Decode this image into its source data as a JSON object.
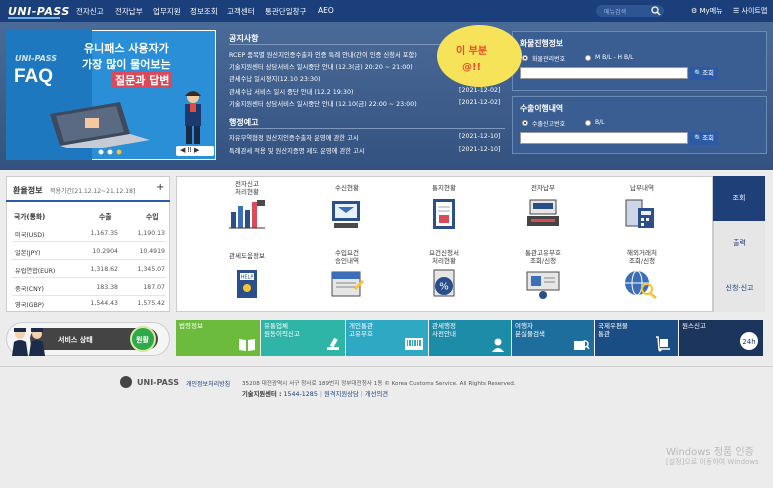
{
  "header": {
    "logo": "UNI-PASS",
    "nav": [
      "전자신고",
      "전자납부",
      "업무지원",
      "정보조회",
      "고객센터",
      "통관단일창구",
      "AEO"
    ],
    "search_placeholder": "메뉴검색",
    "my_menu": "My메뉴",
    "sitemap": "사이트맵"
  },
  "banner": {
    "logo": "UNI-PASS",
    "faq": "FAQ",
    "headline_1": "유니패스 사용자가",
    "headline_2": "가장 많이 물어보는",
    "headline_3": "질문과 답변",
    "controls": "◀ II ▶"
  },
  "notice": {
    "title": "공지사항",
    "items": [
      {
        "text": "RCEP 품목별 원산지인증수출자 인증 특례 안내(간이 인증 신청서 포함)",
        "date": ""
      },
      {
        "text": "기술지원센터 상담서비스 일시중단 안내 (12.3(금) 20:20 ~ 21:00)",
        "date": ""
      },
      {
        "text": "관세수납 일시정지(12.10 23:30)",
        "date": ""
      },
      {
        "text": "관세수납 서비스 일시 중단 안내 (12.2 19:30)",
        "date": "[2021-12-02]"
      },
      {
        "text": "기술지원센터 상담서비스 일시중단 안내 (12.10(금) 22:00 ~ 23:00)",
        "date": "[2021-12-02]"
      }
    ]
  },
  "admin_notice": {
    "title": "행정예고",
    "items": [
      {
        "text": "자유무역협정 원산지인증수출자 운영에 관한 고시",
        "date": "[2021-12-10]"
      },
      {
        "text": "특례관세 적용 및 원산지증명 제도 운영에 관한 고시",
        "date": "[2021-12-10]"
      }
    ]
  },
  "cargo": {
    "title": "화물진행정보",
    "radio_1": "화물관리번호",
    "radio_2": "M B/L - H B/L",
    "button": "조회"
  },
  "export": {
    "title": "수출이행내역",
    "radio_1": "수출신고번호",
    "radio_2": "B/L",
    "button": "조회"
  },
  "bubble": {
    "line_1": "이 부분",
    "line_2": "@!!",
    "color": "#f7e35a"
  },
  "rates": {
    "title": "환율정보",
    "period": "적용기간[21.12.12~21.12.18]",
    "plus": "+",
    "headers": [
      "국가(통화)",
      "수출",
      "수입"
    ],
    "rows": [
      {
        "country": "미국(USD)",
        "export": "1,167.35",
        "import": "1,190.13"
      },
      {
        "country": "일본(JPY)",
        "export": "10.2904",
        "import": "10.4919"
      },
      {
        "country": "유럽연합(EUR)",
        "export": "1,318.62",
        "import": "1,345.07"
      },
      {
        "country": "중국(CNY)",
        "export": "183.38",
        "import": "187.07"
      },
      {
        "country": "영국(GBP)",
        "export": "1,544.43",
        "import": "1,575.42"
      }
    ]
  },
  "status": {
    "label": "서비스 상태",
    "state": "원활"
  },
  "services": [
    {
      "label": "전자신고\n처리현황",
      "icon": "bar-chart-icon"
    },
    {
      "label": "수신현황",
      "icon": "mail-monitor-icon"
    },
    {
      "label": "통지현황",
      "icon": "document-icon"
    },
    {
      "label": "전자납부",
      "icon": "payment-terminal-icon"
    },
    {
      "label": "납부내역",
      "icon": "receipt-calculator-icon"
    },
    {
      "label": "관세도움정보",
      "icon": "help-book-icon"
    },
    {
      "label": "수입요건\n승인내역",
      "icon": "import-doc-icon"
    },
    {
      "label": "요건신청서\n처리현황",
      "icon": "percent-doc-icon"
    },
    {
      "label": "통관고유부호\n조회/신청",
      "icon": "id-board-icon"
    },
    {
      "label": "해외거래처\n조회/신청",
      "icon": "globe-search-icon"
    }
  ],
  "tabs": [
    "조회",
    "출력",
    "신청·신고"
  ],
  "quick_links": [
    {
      "label": "법령정보",
      "color": "#6dbb3d"
    },
    {
      "label": "유통업체\n원동이력신고",
      "color": "#2fb5a8"
    },
    {
      "label": "개인통관\n고유부호",
      "color": "#2fa8c4"
    },
    {
      "label": "관세행정\n사전안내",
      "color": "#1c8ca8"
    },
    {
      "label": "여행자\n분실물검색",
      "color": "#1d6e9c"
    },
    {
      "label": "국제우편물\n통관",
      "color": "#1a4d84"
    },
    {
      "label": "원스신고",
      "color": "#1c355c"
    }
  ],
  "footer": {
    "logo": "UNI-PASS",
    "privacy": "개인정보처리방침",
    "address": "35208 대전광역시 서구 청사로 189번지 정부대전청사 1동 © Korea Customs Service. All Rights Reserved.",
    "tel_label": "기술지원센터 :",
    "tel": "1544-1285",
    "remote": "원격지원상담",
    "feedback": "개선의견"
  },
  "watermark": {
    "line_1": "Windows 정품 인증",
    "line_2": "[설정]으로 이동하여 Windows"
  }
}
